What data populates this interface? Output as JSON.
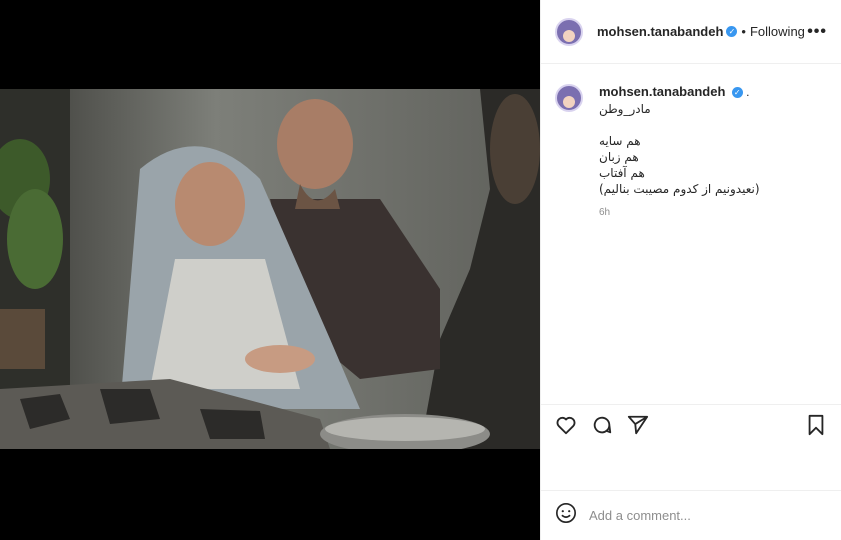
{
  "header": {
    "username": "mohsen.tanabandeh",
    "separator": "•",
    "follow_status": "Following",
    "more_label": "•••"
  },
  "caption": {
    "username": "mohsen.tanabandeh",
    "suffix": ".",
    "text": "مادر_وطن\n\nهم سایه\nهم زبان\nهم آفتاب\n(نعیدونیم از کدوم مصیبت بنالیم)",
    "time": "6h"
  },
  "icons": {
    "like": "heart-icon",
    "comment": "comment-icon",
    "share": "paper-plane-icon",
    "save": "bookmark-icon",
    "emoji": "smiley-icon",
    "verified": "verified-badge-icon"
  },
  "comment": {
    "placeholder": "Add a comment..."
  },
  "colors": {
    "verified": "#3897f0",
    "text": "#262626",
    "muted": "#8e8e8e",
    "divider": "#efefef"
  }
}
